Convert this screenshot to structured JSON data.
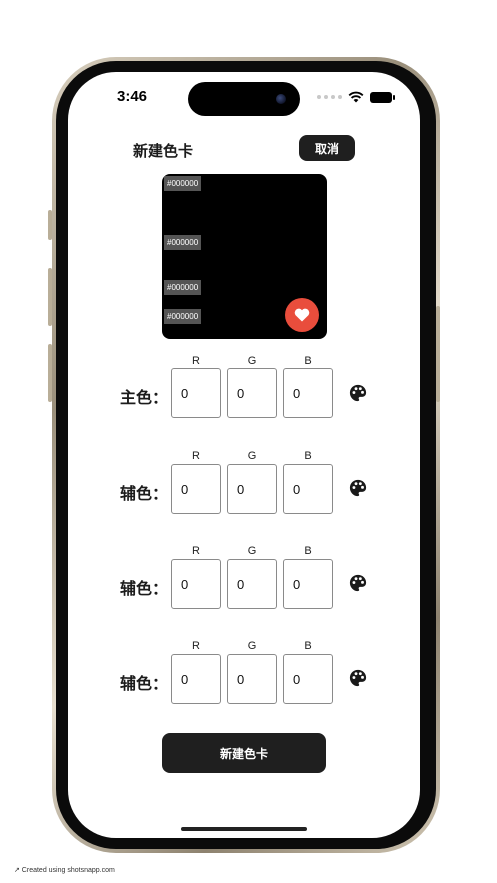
{
  "status_bar": {
    "time": "3:46"
  },
  "header": {
    "title": "新建色卡",
    "cancel_label": "取消"
  },
  "preview": {
    "background": "#000000",
    "hex_tags": [
      "#000000",
      "#000000",
      "#000000",
      "#000000"
    ],
    "favorite_color": "#e94d3c"
  },
  "channels": [
    "R",
    "G",
    "B"
  ],
  "color_rows": [
    {
      "label": "主色：",
      "r": "0",
      "g": "0",
      "b": "0"
    },
    {
      "label": "辅色：",
      "r": "0",
      "g": "0",
      "b": "0"
    },
    {
      "label": "辅色：",
      "r": "0",
      "g": "0",
      "b": "0"
    },
    {
      "label": "辅色：",
      "r": "0",
      "g": "0",
      "b": "0"
    }
  ],
  "submit_label": "新建色卡",
  "credit": "↗ Created using shotsnapp.com"
}
